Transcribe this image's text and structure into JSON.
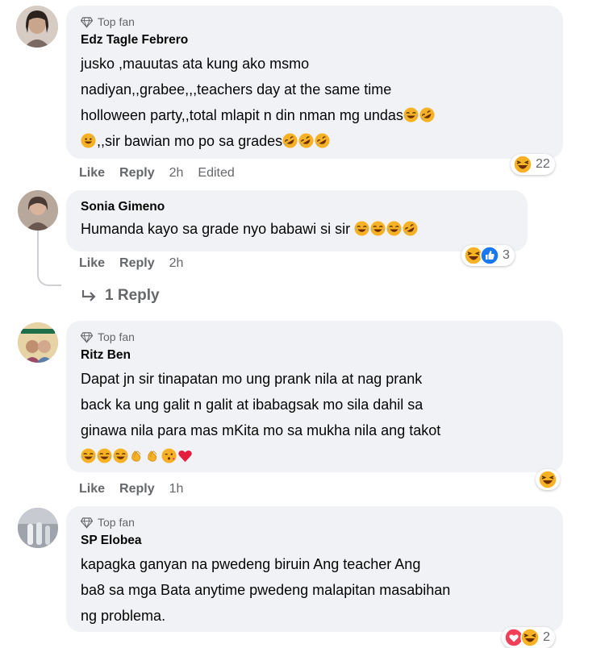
{
  "comments": [
    {
      "badge": "Top fan",
      "author": "Edz Tagle Febrero",
      "text_lines": [
        "jusko ,mauutas ata kung ako msmo",
        "nadiyan,,grabee,,,teachers day at the same time",
        "holloween party,,total mlapit n din nman mg undas",
        ",,sir bawian mo po sa grades"
      ],
      "like": "Like",
      "reply": "Reply",
      "time": "2h",
      "edited": "Edited",
      "reaction_count": "22",
      "avatar_color": "#b9a79a"
    },
    {
      "author": "Sonia Gimeno",
      "text": "Humanda kayo sa grade nyo babawi si sir",
      "like": "Like",
      "reply": "Reply",
      "time": "2h",
      "reaction_count": "3",
      "view_replies": "1 Reply",
      "avatar_color": "#a88f7e"
    },
    {
      "badge": "Top fan",
      "author": "Ritz Ben",
      "text_lines": [
        "Dapat jn sir tinapatan mo ung prank nila at nag prank",
        "back ka ung galit n galit at ibabagsak mo sila dahil sa",
        "ginawa nila para mas mKita mo sa mukha nila ang takot"
      ],
      "like": "Like",
      "reply": "Reply",
      "time": "1h",
      "avatar_color": "#d9c08a"
    },
    {
      "badge": "Top fan",
      "author": "SP Elobea",
      "text_lines": [
        "kapagka ganyan na pwedeng biruin Ang teacher Ang",
        "ba8 sa mga Bata anytime pwedeng malapitan masabihan",
        "ng problema."
      ],
      "reaction_count": "2",
      "avatar_color": "#8d8f96"
    }
  ],
  "colors": {
    "bubble": "#f0f2f5",
    "meta": "#65676b",
    "like_blue": "#1877f2",
    "love_red": "#f33e58",
    "haha_yellow": "#f7b125"
  },
  "icons": [
    "top-fan-diamond-icon",
    "laugh-tears-emoji-icon",
    "rofl-emoji-icon",
    "grin-sweat-emoji-icon",
    "clap-emoji-icon",
    "wink-kiss-emoji-icon",
    "heart-emoji-icon",
    "reply-arrow-icon",
    "haha-reaction-icon",
    "like-reaction-icon",
    "love-reaction-icon"
  ]
}
